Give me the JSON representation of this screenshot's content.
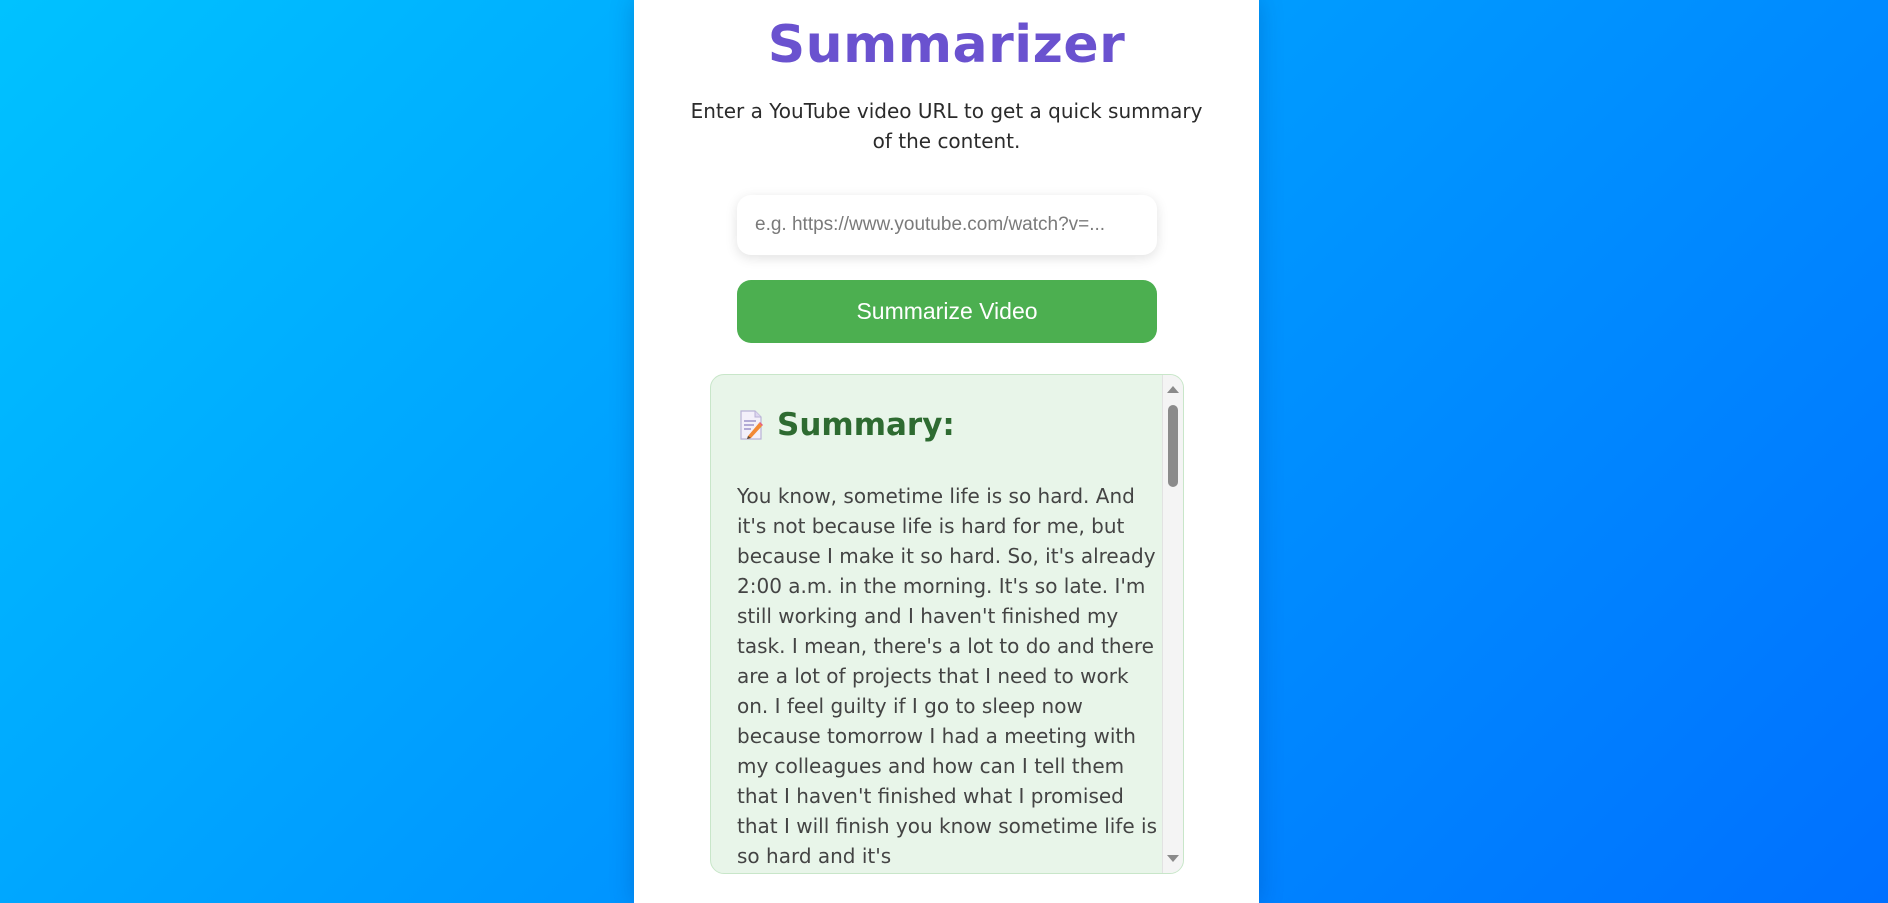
{
  "app": {
    "title": "Summarizer",
    "subtitle": "Enter a YouTube video URL to get a quick summary of the content."
  },
  "form": {
    "url_value": "",
    "url_placeholder": "e.g. https://www.youtube.com/watch?v=...",
    "submit_label": "Summarize Video"
  },
  "summary": {
    "icon": "memo-icon",
    "heading": "Summary:",
    "text": "You know, sometime life is so hard. And it's not because life is hard for me, but because I make it so hard. So, it's already 2:00 a.m. in the morning. It's so late. I'm still working and I haven't finished my task. I mean, there's a lot to do and there are a lot of projects that I need to work on. I feel guilty if I go to sleep now because tomorrow I had a meeting with my colleagues and how can I tell them that I haven't finished what I promised that I will finish you know sometime life is so hard and it's"
  },
  "colors": {
    "title": "#6a52cf",
    "button": "#4caf50",
    "summary_background": "#e8f5e9",
    "summary_heading": "#2e6b31",
    "page_gradient_start": "#00c2ff",
    "page_gradient_end": "#0070ff"
  }
}
